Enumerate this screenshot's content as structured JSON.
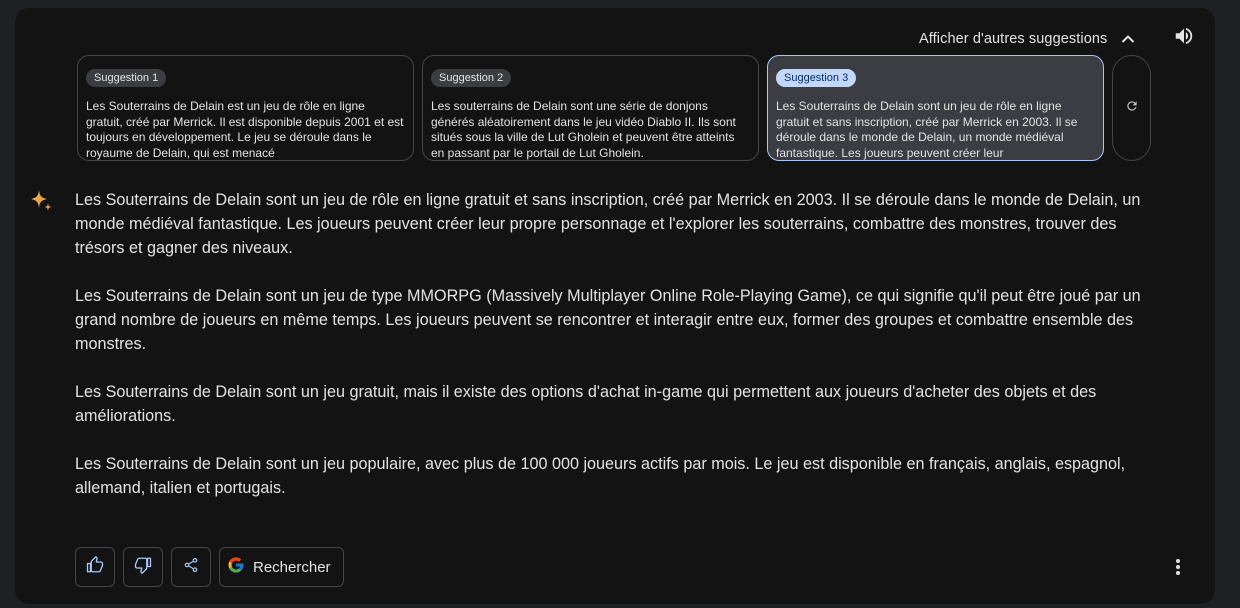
{
  "header": {
    "toggle_label": "Afficher d'autres suggestions",
    "chevron_icon": "chevron-up-icon",
    "speaker_icon": "volume-icon"
  },
  "drafts": [
    {
      "label": "Suggestion 1",
      "text": "Les Souterrains de Delain est un jeu de rôle en ligne gratuit, créé par Merrick. Il est disponible depuis 2001 et est toujours en développement. Le jeu se déroule dans le royaume de Delain, qui est menacé",
      "selected": false
    },
    {
      "label": "Suggestion 2",
      "text": "Les souterrains de Delain sont une série de donjons générés aléatoirement dans le jeu vidéo Diablo II. Ils sont situés sous la ville de Lut Gholein et peuvent être atteints en passant par le portail de Lut Gholein.",
      "selected": false
    },
    {
      "label": "Suggestion 3",
      "text": "Les Souterrains de Delain sont un jeu de rôle en ligne gratuit et sans inscription, créé par Merrick en 2003. Il se déroule dans le monde de Delain, un monde médiéval fantastique. Les joueurs peuvent créer leur",
      "selected": true
    }
  ],
  "regenerate_icon": "refresh-icon",
  "response": {
    "paragraphs": [
      "Les Souterrains de Delain sont un jeu de rôle en ligne gratuit et sans inscription, créé par Merrick en 2003. Il se déroule dans le monde de Delain, un monde médiéval fantastique. Les joueurs peuvent créer leur propre personnage et l'explorer les souterrains, combattre des monstres, trouver des trésors et gagner des niveaux.",
      "Les Souterrains de Delain sont un jeu de type MMORPG (Massively Multiplayer Online Role-Playing Game), ce qui signifie qu'il peut être joué par un grand nombre de joueurs en même temps. Les joueurs peuvent se rencontrer et interagir entre eux, former des groupes et combattre ensemble des monstres.",
      "Les Souterrains de Delain sont un jeu gratuit, mais il existe des options d'achat in-game qui permettent aux joueurs d'acheter des objets et des améliorations.",
      "Les Souterrains de Delain sont un jeu populaire, avec plus de 100 000 joueurs actifs par mois. Le jeu est disponible en français, anglais, espagnol, allemand, italien et portugais."
    ]
  },
  "actions": {
    "search_label": "Rechercher",
    "icons": [
      "thumbs-up-icon",
      "thumbs-down-icon",
      "share-icon",
      "google-icon",
      "more-vert-icon"
    ]
  },
  "colors": {
    "background": "#131314",
    "page": "#1f2023",
    "accent": "#a8c7fa",
    "selected_pill": "#c2d7fb"
  }
}
